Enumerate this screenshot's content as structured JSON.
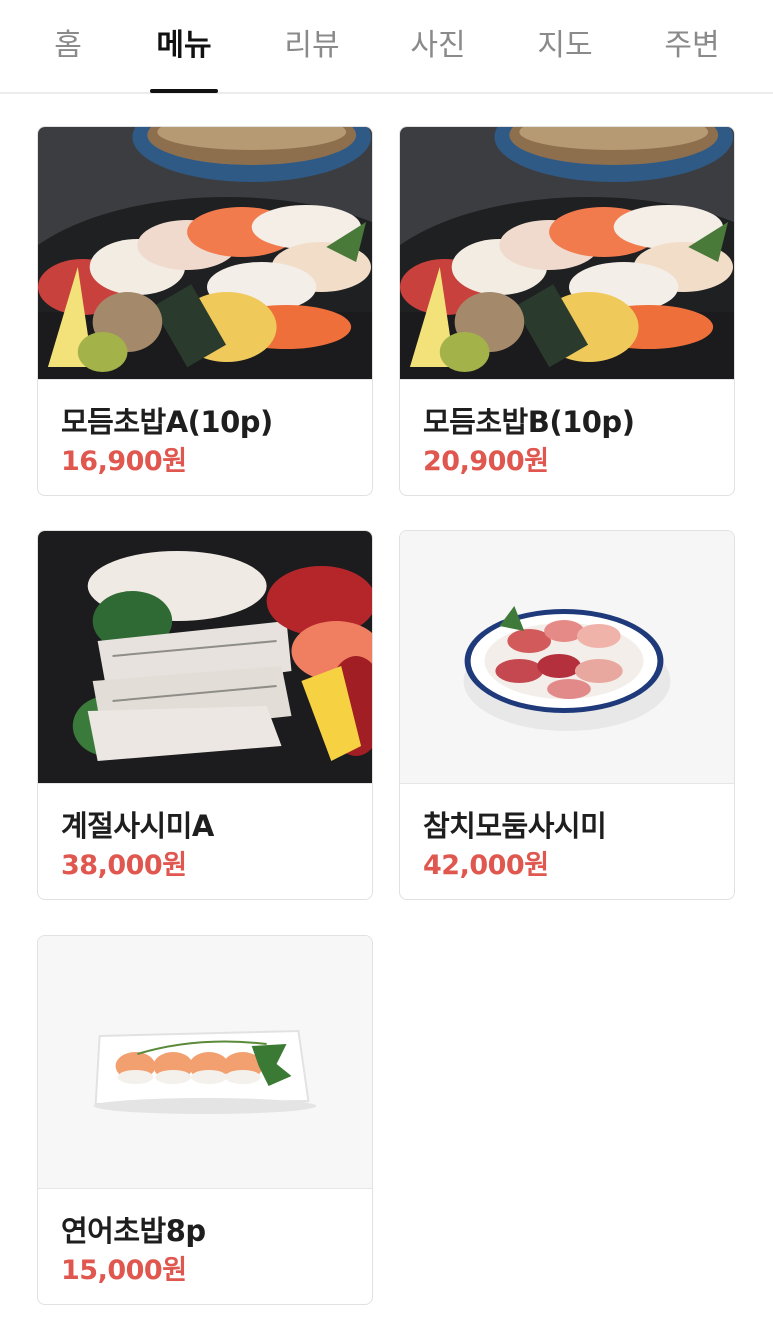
{
  "tabs": [
    {
      "label": "홈",
      "active": false
    },
    {
      "label": "메뉴",
      "active": true
    },
    {
      "label": "리뷰",
      "active": false
    },
    {
      "label": "사진",
      "active": false
    },
    {
      "label": "지도",
      "active": false
    },
    {
      "label": "주변",
      "active": false
    }
  ],
  "colors": {
    "price": "#e0574f",
    "active_tab": "#111111",
    "inactive_tab": "#8a8a8a"
  },
  "menu": [
    {
      "name": "모듬초밥A(10p)",
      "price": "16,900원",
      "image": "assorted-sushi-photo"
    },
    {
      "name": "모듬초밥B(10p)",
      "price": "20,900원",
      "image": "assorted-sushi-photo"
    },
    {
      "name": "계절사시미A",
      "price": "38,000원",
      "image": "seasonal-sashimi-photo"
    },
    {
      "name": "참치모둠사시미",
      "price": "42,000원",
      "image": "tuna-sashimi-plate-photo"
    },
    {
      "name": "연어초밥8p",
      "price": "15,000원",
      "image": "salmon-sushi-photo"
    }
  ]
}
